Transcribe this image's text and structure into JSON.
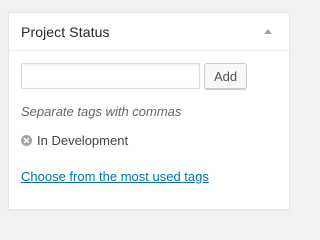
{
  "postbox": {
    "title": "Project Status"
  },
  "tag_input": {
    "value": "",
    "placeholder": ""
  },
  "add_button_label": "Add",
  "help_text": "Separate tags with commas",
  "tags": [
    {
      "label": "In Development",
      "remove_icon": "remove-circle-icon"
    }
  ],
  "choose_link_text": "Choose from the most used tags",
  "colors": {
    "link": "#0073aa",
    "title": "#23282d",
    "help_text": "#666666",
    "remove_icon": "#a0a5aa"
  }
}
